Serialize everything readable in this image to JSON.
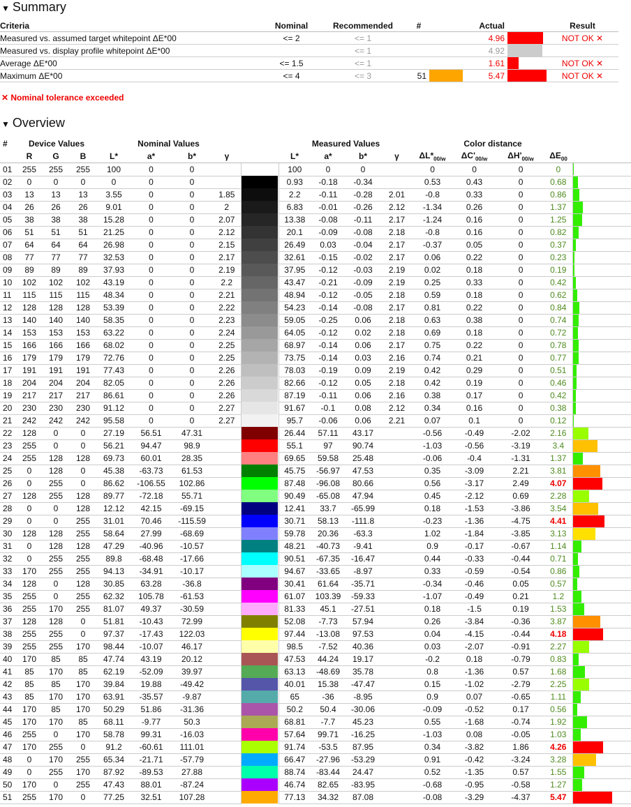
{
  "summary": {
    "title": "Summary",
    "headers": [
      "Criteria",
      "Nominal",
      "Recommended",
      "#",
      "Actual",
      "Result"
    ],
    "rows": [
      {
        "criteria": "Measured vs. assumed target whitepoint ΔE*00",
        "nominal": "<= 2",
        "recommended": "<= 1",
        "num": "",
        "actual": "4.96",
        "actual_state": "bad",
        "bar_value": 4.96,
        "bar_color": "#ff0000",
        "result": "NOT OK ✕"
      },
      {
        "criteria": "Measured vs. display profile whitepoint ΔE*00",
        "nominal": "",
        "recommended": "<= 1",
        "num": "",
        "actual": "4.92",
        "actual_state": "info",
        "bar_value": 4.92,
        "bar_color": "#cccccc",
        "result": ""
      },
      {
        "criteria": "Average ΔE*00",
        "nominal": "<= 1.5",
        "recommended": "<= 1",
        "num": "",
        "actual": "1.61",
        "actual_state": "bad",
        "bar_value": 1.61,
        "bar_color": "#ff0000",
        "result": "NOT OK ✕"
      },
      {
        "criteria": "Maximum ΔE*00",
        "nominal": "<= 4",
        "recommended": "<= 3",
        "num": "51",
        "num_swatch": "#ffa500",
        "actual": "5.47",
        "actual_state": "bad",
        "bar_value": 5.47,
        "bar_color": "#ff0000",
        "result": "NOT OK ✕"
      }
    ],
    "note": "✕ Nominal tolerance exceeded"
  },
  "overview": {
    "title": "Overview",
    "groups": [
      "#",
      "Device Values",
      "Nominal Values",
      "Measured Values",
      "Color distance"
    ],
    "columns": [
      "R",
      "G",
      "B",
      "L*",
      "a*",
      "b*",
      "γ",
      "L*",
      "a*",
      "b*",
      "γ",
      "ΔL*",
      "ΔC'",
      "ΔH'",
      "ΔE"
    ],
    "sub": [
      "00/w",
      "00/w",
      "00/w",
      "00"
    ],
    "rows": [
      [
        "01",
        255,
        255,
        255,
        "100",
        "0",
        "0",
        "",
        "100",
        "0",
        "0",
        "",
        "0",
        "0",
        "0",
        "0"
      ],
      [
        "02",
        0,
        0,
        0,
        "0",
        "0",
        "0",
        "",
        "0.93",
        "-0.18",
        "-0.34",
        "",
        "0.53",
        "0.43",
        "0",
        "0.68"
      ],
      [
        "03",
        13,
        13,
        13,
        "3.55",
        "0",
        "0",
        "1.85",
        "2.2",
        "-0.11",
        "-0.28",
        "2.01",
        "-0.8",
        "0.33",
        "0",
        "0.86"
      ],
      [
        "04",
        26,
        26,
        26,
        "9.01",
        "0",
        "0",
        "2",
        "6.83",
        "-0.01",
        "-0.26",
        "2.12",
        "-1.34",
        "0.26",
        "0",
        "1.37"
      ],
      [
        "05",
        38,
        38,
        38,
        "15.28",
        "0",
        "0",
        "2.07",
        "13.38",
        "-0.08",
        "-0.11",
        "2.17",
        "-1.24",
        "0.16",
        "0",
        "1.25"
      ],
      [
        "06",
        51,
        51,
        51,
        "21.25",
        "0",
        "0",
        "2.12",
        "20.1",
        "-0.09",
        "-0.08",
        "2.18",
        "-0.8",
        "0.16",
        "0",
        "0.82"
      ],
      [
        "07",
        64,
        64,
        64,
        "26.98",
        "0",
        "0",
        "2.15",
        "26.49",
        "0.03",
        "-0.04",
        "2.17",
        "-0.37",
        "0.05",
        "0",
        "0.37"
      ],
      [
        "08",
        77,
        77,
        77,
        "32.53",
        "0",
        "0",
        "2.17",
        "32.61",
        "-0.15",
        "-0.02",
        "2.17",
        "0.06",
        "0.22",
        "0",
        "0.23"
      ],
      [
        "09",
        89,
        89,
        89,
        "37.93",
        "0",
        "0",
        "2.19",
        "37.95",
        "-0.12",
        "-0.03",
        "2.19",
        "0.02",
        "0.18",
        "0",
        "0.19"
      ],
      [
        "10",
        102,
        102,
        102,
        "43.19",
        "0",
        "0",
        "2.2",
        "43.47",
        "-0.21",
        "-0.09",
        "2.19",
        "0.25",
        "0.33",
        "0",
        "0.42"
      ],
      [
        "11",
        115,
        115,
        115,
        "48.34",
        "0",
        "0",
        "2.21",
        "48.94",
        "-0.12",
        "-0.05",
        "2.18",
        "0.59",
        "0.18",
        "0",
        "0.62"
      ],
      [
        "12",
        128,
        128,
        128,
        "53.39",
        "0",
        "0",
        "2.22",
        "54.23",
        "-0.14",
        "-0.08",
        "2.17",
        "0.81",
        "0.22",
        "0",
        "0.84"
      ],
      [
        "13",
        140,
        140,
        140,
        "58.35",
        "0",
        "0",
        "2.23",
        "59.05",
        "-0.25",
        "0.06",
        "2.18",
        "0.63",
        "0.38",
        "0",
        "0.74"
      ],
      [
        "14",
        153,
        153,
        153,
        "63.22",
        "0",
        "0",
        "2.24",
        "64.05",
        "-0.12",
        "0.02",
        "2.18",
        "0.69",
        "0.18",
        "0",
        "0.72"
      ],
      [
        "15",
        166,
        166,
        166,
        "68.02",
        "0",
        "0",
        "2.25",
        "68.97",
        "-0.14",
        "0.06",
        "2.17",
        "0.75",
        "0.22",
        "0",
        "0.78"
      ],
      [
        "16",
        179,
        179,
        179,
        "72.76",
        "0",
        "0",
        "2.25",
        "73.75",
        "-0.14",
        "0.03",
        "2.16",
        "0.74",
        "0.21",
        "0",
        "0.77"
      ],
      [
        "17",
        191,
        191,
        191,
        "77.43",
        "0",
        "0",
        "2.26",
        "78.03",
        "-0.19",
        "0.09",
        "2.19",
        "0.42",
        "0.29",
        "0",
        "0.51"
      ],
      [
        "18",
        204,
        204,
        204,
        "82.05",
        "0",
        "0",
        "2.26",
        "82.66",
        "-0.12",
        "0.05",
        "2.18",
        "0.42",
        "0.19",
        "0",
        "0.46"
      ],
      [
        "19",
        217,
        217,
        217,
        "86.61",
        "0",
        "0",
        "2.26",
        "87.19",
        "-0.11",
        "0.06",
        "2.16",
        "0.38",
        "0.17",
        "0",
        "0.42"
      ],
      [
        "20",
        230,
        230,
        230,
        "91.12",
        "0",
        "0",
        "2.27",
        "91.67",
        "-0.1",
        "0.08",
        "2.12",
        "0.34",
        "0.16",
        "0",
        "0.38"
      ],
      [
        "21",
        242,
        242,
        242,
        "95.58",
        "0",
        "0",
        "2.27",
        "95.7",
        "-0.06",
        "0.06",
        "2.21",
        "0.07",
        "0.1",
        "0",
        "0.12"
      ],
      [
        "22",
        128,
        0,
        0,
        "27.19",
        "56.51",
        "47.31",
        "",
        "26.44",
        "57.11",
        "43.17",
        "",
        "-0.56",
        "-0.49",
        "-2.02",
        "2.16"
      ],
      [
        "23",
        255,
        0,
        0,
        "56.21",
        "94.47",
        "98.9",
        "",
        "55.1",
        "97",
        "90.74",
        "",
        "-1.03",
        "-0.56",
        "-3.19",
        "3.4"
      ],
      [
        "24",
        255,
        128,
        128,
        "69.73",
        "60.01",
        "28.35",
        "",
        "69.65",
        "59.58",
        "25.48",
        "",
        "-0.06",
        "-0.4",
        "-1.31",
        "1.37"
      ],
      [
        "25",
        0,
        128,
        0,
        "45.38",
        "-63.73",
        "61.53",
        "",
        "45.75",
        "-56.97",
        "47.53",
        "",
        "0.35",
        "-3.09",
        "2.21",
        "3.81"
      ],
      [
        "26",
        0,
        255,
        0,
        "86.62",
        "-106.55",
        "102.86",
        "",
        "87.48",
        "-96.08",
        "80.66",
        "",
        "0.56",
        "-3.17",
        "2.49",
        "4.07"
      ],
      [
        "27",
        128,
        255,
        128,
        "89.77",
        "-72.18",
        "55.71",
        "",
        "90.49",
        "-65.08",
        "47.94",
        "",
        "0.45",
        "-2.12",
        "0.69",
        "2.28"
      ],
      [
        "28",
        0,
        0,
        128,
        "12.12",
        "42.15",
        "-69.15",
        "",
        "12.41",
        "33.7",
        "-65.99",
        "",
        "0.18",
        "-1.53",
        "-3.86",
        "3.54"
      ],
      [
        "29",
        0,
        0,
        255,
        "31.01",
        "70.46",
        "-115.59",
        "",
        "30.71",
        "58.13",
        "-111.8",
        "",
        "-0.23",
        "-1.36",
        "-4.75",
        "4.41"
      ],
      [
        "30",
        128,
        128,
        255,
        "58.64",
        "27.99",
        "-68.69",
        "",
        "59.78",
        "20.36",
        "-63.3",
        "",
        "1.02",
        "-1.84",
        "-3.85",
        "3.13"
      ],
      [
        "31",
        0,
        128,
        128,
        "47.29",
        "-40.96",
        "-10.57",
        "",
        "48.21",
        "-40.73",
        "-9.41",
        "",
        "0.9",
        "-0.17",
        "-0.67",
        "1.14"
      ],
      [
        "32",
        0,
        255,
        255,
        "89.8",
        "-68.48",
        "-17.66",
        "",
        "90.51",
        "-67.35",
        "-16.47",
        "",
        "0.44",
        "-0.33",
        "-0.44",
        "0.71"
      ],
      [
        "33",
        170,
        255,
        255,
        "94.13",
        "-34.91",
        "-10.17",
        "",
        "94.67",
        "-33.65",
        "-8.97",
        "",
        "0.33",
        "-0.59",
        "-0.54",
        "0.86"
      ],
      [
        "34",
        128,
        0,
        128,
        "30.85",
        "63.28",
        "-36.8",
        "",
        "30.41",
        "61.64",
        "-35.71",
        "",
        "-0.34",
        "-0.46",
        "0.05",
        "0.57"
      ],
      [
        "35",
        255,
        0,
        255,
        "62.32",
        "105.78",
        "-61.53",
        "",
        "61.07",
        "103.39",
        "-59.33",
        "",
        "-1.07",
        "-0.49",
        "0.21",
        "1.2"
      ],
      [
        "36",
        255,
        170,
        255,
        "81.07",
        "49.37",
        "-30.59",
        "",
        "81.33",
        "45.1",
        "-27.51",
        "",
        "0.18",
        "-1.5",
        "0.19",
        "1.53"
      ],
      [
        "37",
        128,
        128,
        0,
        "51.81",
        "-10.43",
        "72.99",
        "",
        "52.08",
        "-7.73",
        "57.94",
        "",
        "0.26",
        "-3.84",
        "-0.36",
        "3.87"
      ],
      [
        "38",
        255,
        255,
        0,
        "97.37",
        "-17.43",
        "122.03",
        "",
        "97.44",
        "-13.08",
        "97.53",
        "",
        "0.04",
        "-4.15",
        "-0.44",
        "4.18"
      ],
      [
        "39",
        255,
        255,
        170,
        "98.44",
        "-10.07",
        "46.17",
        "",
        "98.5",
        "-7.52",
        "40.36",
        "",
        "0.03",
        "-2.07",
        "-0.91",
        "2.27"
      ],
      [
        "40",
        170,
        85,
        85,
        "47.74",
        "43.19",
        "20.12",
        "",
        "47.53",
        "44.24",
        "19.17",
        "",
        "-0.2",
        "0.18",
        "-0.79",
        "0.83"
      ],
      [
        "41",
        85,
        170,
        85,
        "62.19",
        "-52.09",
        "39.97",
        "",
        "63.13",
        "-48.69",
        "35.78",
        "",
        "0.8",
        "-1.36",
        "0.57",
        "1.68"
      ],
      [
        "42",
        85,
        85,
        170,
        "39.84",
        "19.88",
        "-49.42",
        "",
        "40.01",
        "15.38",
        "-47.47",
        "",
        "0.15",
        "-1.02",
        "-2.79",
        "2.25"
      ],
      [
        "43",
        85,
        170,
        170,
        "63.91",
        "-35.57",
        "-9.87",
        "",
        "65",
        "-36",
        "-8.95",
        "",
        "0.9",
        "0.07",
        "-0.65",
        "1.11"
      ],
      [
        "44",
        170,
        85,
        170,
        "50.29",
        "51.86",
        "-31.36",
        "",
        "50.2",
        "50.4",
        "-30.06",
        "",
        "-0.09",
        "-0.52",
        "0.17",
        "0.56"
      ],
      [
        "45",
        170,
        170,
        85,
        "68.11",
        "-9.77",
        "50.3",
        "",
        "68.81",
        "-7.7",
        "45.23",
        "",
        "0.55",
        "-1.68",
        "-0.74",
        "1.92"
      ],
      [
        "46",
        255,
        0,
        170,
        "58.78",
        "99.31",
        "-16.03",
        "",
        "57.64",
        "99.71",
        "-16.25",
        "",
        "-1.03",
        "0.08",
        "-0.05",
        "1.03"
      ],
      [
        "47",
        170,
        255,
        0,
        "91.2",
        "-60.61",
        "111.01",
        "",
        "91.74",
        "-53.5",
        "87.95",
        "",
        "0.34",
        "-3.82",
        "1.86",
        "4.26"
      ],
      [
        "48",
        0,
        170,
        255,
        "65.34",
        "-21.71",
        "-57.79",
        "",
        "66.47",
        "-27.96",
        "-53.29",
        "",
        "0.91",
        "-0.42",
        "-3.24",
        "3.28"
      ],
      [
        "49",
        0,
        255,
        170,
        "87.92",
        "-89.53",
        "27.88",
        "",
        "88.74",
        "-83.44",
        "24.47",
        "",
        "0.52",
        "-1.35",
        "0.57",
        "1.55"
      ],
      [
        "50",
        170,
        0,
        255,
        "47.43",
        "88.01",
        "-87.24",
        "",
        "46.74",
        "82.65",
        "-83.95",
        "",
        "-0.68",
        "-0.95",
        "-0.58",
        "1.27"
      ],
      [
        "51",
        255,
        170,
        0,
        "77.25",
        "32.51",
        "107.28",
        "",
        "77.13",
        "34.32",
        "87.08",
        "",
        "-0.08",
        "-3.29",
        "-4.37",
        "5.47"
      ]
    ]
  }
}
